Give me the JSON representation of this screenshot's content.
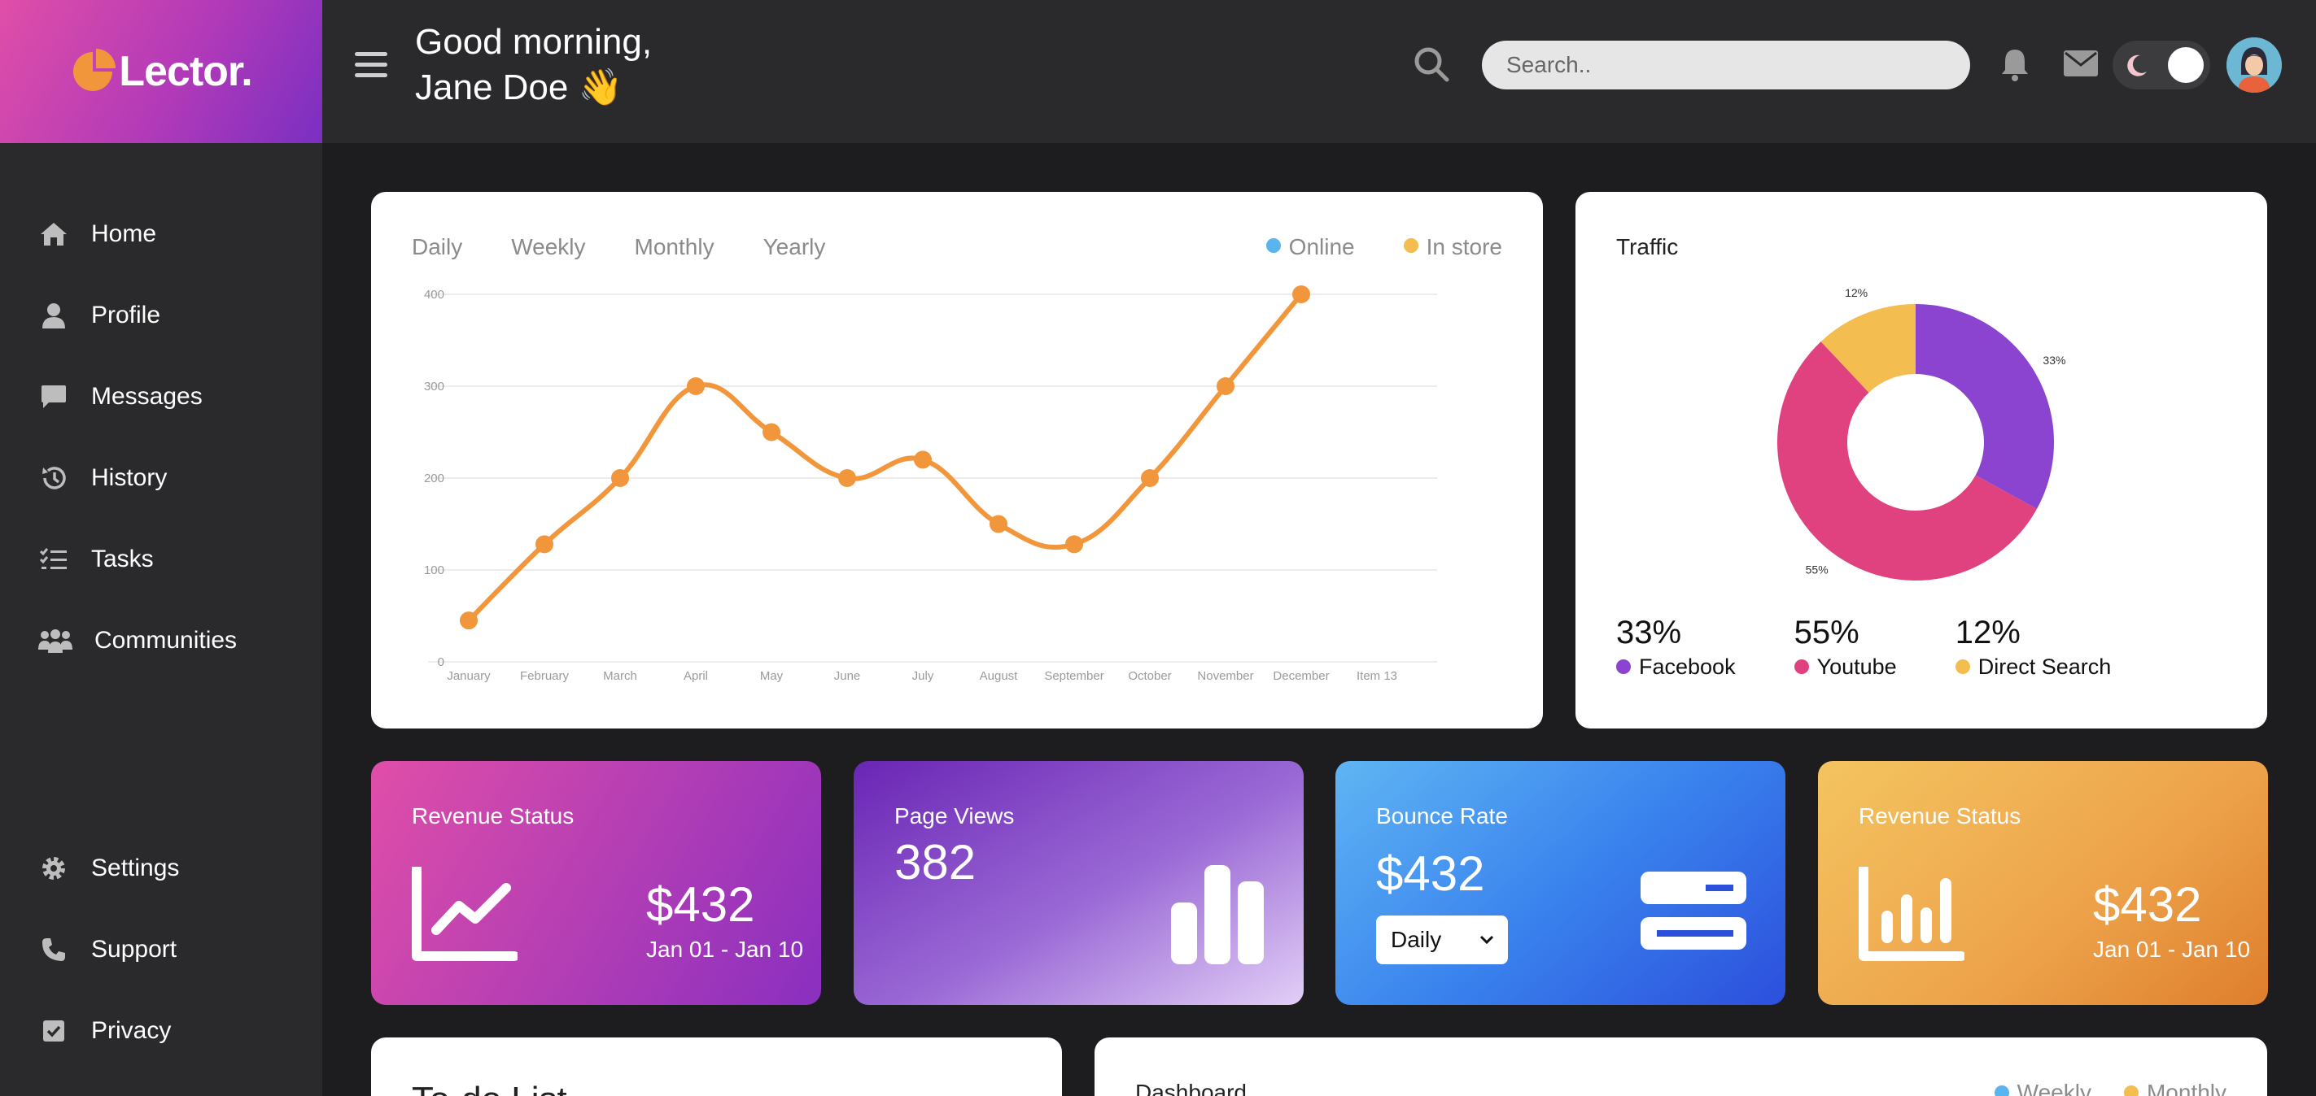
{
  "app": {
    "logo": "Lector."
  },
  "header": {
    "greeting_line1": "Good morning,",
    "greeting_line2": "Jane Doe 👋",
    "search_placeholder": "Search.."
  },
  "sidebar": {
    "items": [
      {
        "label": "Home",
        "icon": "home-icon"
      },
      {
        "label": "Profile",
        "icon": "user-icon"
      },
      {
        "label": "Messages",
        "icon": "chat-icon"
      },
      {
        "label": "History",
        "icon": "history-icon"
      },
      {
        "label": "Tasks",
        "icon": "tasks-icon"
      },
      {
        "label": "Communities",
        "icon": "people-icon"
      }
    ],
    "bottom_items": [
      {
        "label": "Settings",
        "icon": "gear-icon"
      },
      {
        "label": "Support",
        "icon": "phone-icon"
      },
      {
        "label": "Privacy",
        "icon": "checkbox-icon"
      }
    ]
  },
  "sales_chart": {
    "tabs": [
      "Daily",
      "Weekly",
      "Monthly",
      "Yearly"
    ],
    "legend": [
      {
        "label": "Online",
        "color": "#5ab4ee"
      },
      {
        "label": "In store",
        "color": "#f3bd4f"
      }
    ]
  },
  "traffic": {
    "title": "Traffic",
    "stats": [
      {
        "pct": "33%",
        "label": "Facebook",
        "color": "#8a44cf"
      },
      {
        "pct": "55%",
        "label": "Youtube",
        "color": "#e0427f"
      },
      {
        "pct": "12%",
        "label": "Direct Search",
        "color": "#f3bd4f"
      }
    ]
  },
  "stat_cards": {
    "revenue1": {
      "title": "Revenue Status",
      "value": "$432",
      "range": "Jan 01 - Jan 10"
    },
    "pageviews": {
      "title": "Page Views",
      "value": "382"
    },
    "bounce": {
      "title": "Bounce Rate",
      "value": "$432",
      "select": "Daily"
    },
    "revenue2": {
      "title": "Revenue Status",
      "value": "$432",
      "range": "Jan 01 - Jan 10"
    }
  },
  "bottom": {
    "todo_title": "To-do List",
    "dashboard_title": "Dashboard",
    "dashboard_legend": [
      {
        "label": "Weekly",
        "color": "#5ab4ee"
      },
      {
        "label": "Monthly",
        "color": "#f3bd4f"
      }
    ]
  },
  "chart_data": [
    {
      "type": "line",
      "categories": [
        "January",
        "February",
        "March",
        "April",
        "May",
        "June",
        "July",
        "August",
        "September",
        "October",
        "November",
        "December",
        "Item 13"
      ],
      "series": [
        {
          "values": [
            45,
            128,
            200,
            300,
            250,
            200,
            220,
            150,
            128,
            200,
            300,
            400
          ],
          "color": "#f2963c"
        }
      ],
      "yticks": [
        0,
        100,
        200,
        300,
        400
      ],
      "ylim": [
        0,
        400
      ],
      "grid": true
    },
    {
      "type": "pie",
      "donut": true,
      "slices": [
        {
          "label": "Facebook",
          "value": 33,
          "color": "#8a44cf",
          "text": "33%"
        },
        {
          "label": "Youtube",
          "value": 55,
          "color": "#e0427f",
          "text": "55%"
        },
        {
          "label": "Direct Search",
          "value": 12,
          "color": "#f3bd4f",
          "text": "12%"
        }
      ]
    }
  ]
}
